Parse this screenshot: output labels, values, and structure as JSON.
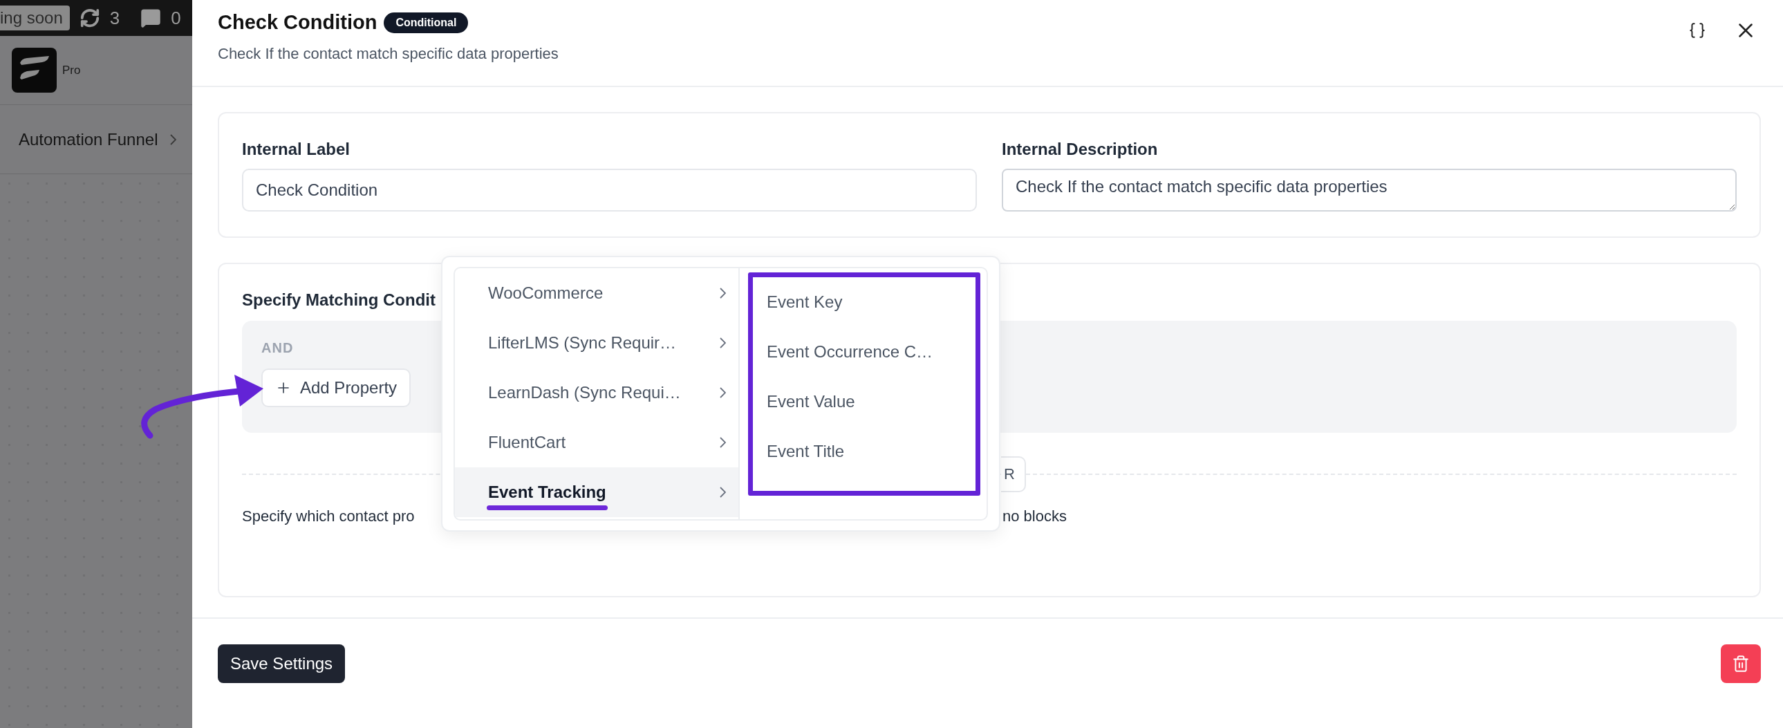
{
  "admin_bar": {
    "badge": "ing soon",
    "updates": "3",
    "comments": "0"
  },
  "sidebar": {
    "brand": "Pro",
    "breadcrumb": "Automation Funnel"
  },
  "drawer": {
    "title": "Check Condition",
    "badge": "Conditional",
    "subtitle": "Check If the contact match specific data properties"
  },
  "fields": [
    {
      "kind": "input",
      "label": "Internal Label",
      "value": "Check Condition"
    },
    {
      "kind": "textarea",
      "label": "Internal Description",
      "value": "Check If the contact match specific data properties"
    }
  ],
  "conditions": {
    "heading": "Specify Matching Condit",
    "group_label": "AND",
    "add_button": "Add Property",
    "or_button": "R",
    "help_left": "Specify which contact pro",
    "help_right": "no blocks"
  },
  "menu": {
    "categories": [
      {
        "label": "WooCommerce",
        "selected": false
      },
      {
        "label": "LifterLMS (Sync Requir…",
        "selected": false
      },
      {
        "label": "LearnDash (Sync Requi…",
        "selected": false
      },
      {
        "label": "FluentCart",
        "selected": false
      },
      {
        "label": "Event Tracking",
        "selected": true
      }
    ],
    "options": [
      "Event Key",
      "Event Occurrence C…",
      "Event Value",
      "Event Title"
    ]
  },
  "footer": {
    "save": "Save Settings"
  }
}
